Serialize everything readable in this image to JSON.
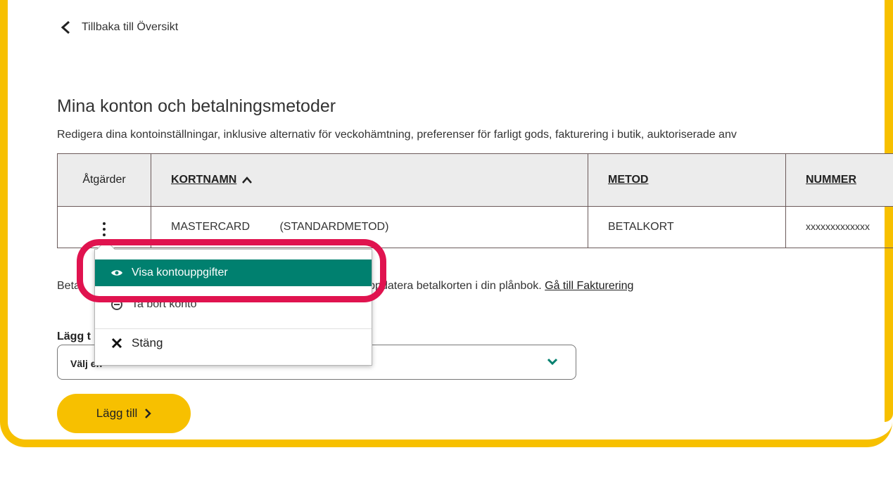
{
  "back_link": {
    "label": "Tillbaka till Översikt"
  },
  "page": {
    "title": "Mina konton och betalningsmetoder",
    "subtitle": "Redigera dina kontoinställningar, inklusive alternativ för veckohämtning, preferenser för farligt gods, fakturering i butik, auktoriserade anv"
  },
  "table": {
    "headers": {
      "actions": "Åtgärder",
      "card_name": "KORTNAMN",
      "method": "METOD",
      "number": "NUMMER"
    },
    "rows": [
      {
        "card_name": "MASTERCARD",
        "note": "(STANDARDMETOD)",
        "method": "BETALKORT",
        "number": "xxxxxxxxxxxxx"
      }
    ]
  },
  "payment_text": {
    "prefix": "Beta",
    "middle": "tt uppdatera betalkorten i din plånbok.",
    "link": "Gå till Fakturering"
  },
  "add_section": {
    "label": "Lägg t",
    "select_value": "Välj en",
    "button_label": "Lägg till"
  },
  "menu": {
    "items": [
      {
        "label": "Visa kontouppgifter",
        "icon": "eye-icon"
      },
      {
        "label": "Ta bort konto",
        "icon": "remove-icon"
      },
      {
        "label": "Stäng",
        "icon": "close-icon"
      }
    ]
  },
  "colors": {
    "brand_yellow": "#f7c000",
    "menu_highlight": "#00806f",
    "annotation": "#e0134f"
  }
}
